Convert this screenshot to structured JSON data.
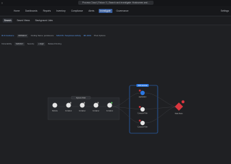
{
  "window": {
    "title": "Process Cloud | Falcon X | Search and investigate: Hostnames and..."
  },
  "nav": {
    "items": [
      "Home",
      "Dashboards",
      "Reports",
      "Inventory",
      "Compliance",
      "Alerts",
      "Investigate",
      "Governance"
    ],
    "active_index": 6,
    "settings_label": "Settings"
  },
  "tabs": {
    "items": [
      "Search",
      "Saved Views",
      "Background Jobs"
    ],
    "active_index": 0
  },
  "filters_row1": {
    "items": [
      "IR & hostname",
      "AWS/EC2",
      "Finding Name: persistence",
      "MACOS / Suspicious Activity",
      "MF-4001",
      "Pivot Options"
    ]
  },
  "filters_row2": {
    "items": [
      "Vulnerability",
      "MANGO",
      "Severity",
      "≥ High",
      "Related Finding"
    ]
  },
  "graph": {
    "group_label": "Ingress chain",
    "right_group_label": "AWS lambda",
    "nodes_left": [
      "Website",
      "Container",
      "Container",
      "Container",
      "Container"
    ],
    "nodes_mid": [
      "application",
      "Compute Role",
      "Compute Role"
    ],
    "target": "Data Store"
  },
  "colors": {
    "accent": "#3a5f9e",
    "highlight": "#2b78e4",
    "danger": "#d9363e"
  }
}
